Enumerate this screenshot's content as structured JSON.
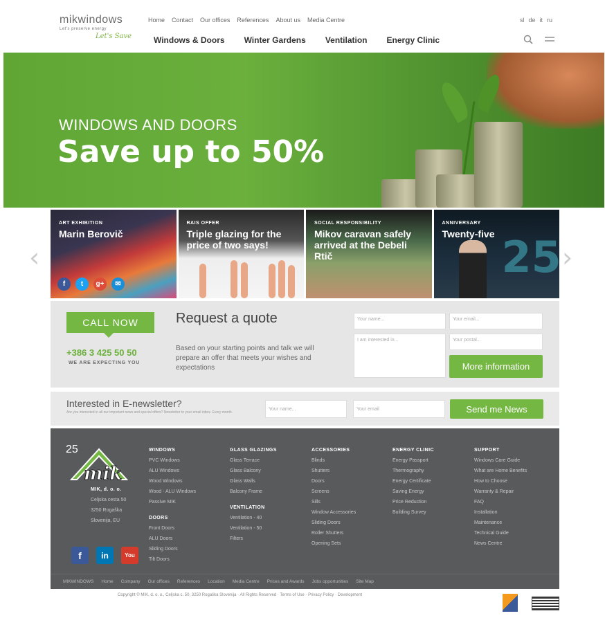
{
  "header": {
    "logo_text": "mikwindows",
    "logo_tagline": "Let's preserve energy",
    "logo_script": "Let's Save",
    "top_nav": [
      "Home",
      "Contact",
      "Our offices",
      "References",
      "About us",
      "Media Centre"
    ],
    "languages": [
      "sl",
      "de",
      "it",
      "ru"
    ],
    "main_nav": [
      "Windows & Doors",
      "Winter Gardens",
      "Ventilation",
      "Energy Clinic"
    ]
  },
  "hero": {
    "kicker": "WINDOWS AND DOORS",
    "title": "Save up to 50%"
  },
  "cards": [
    {
      "kicker": "ART EXHIBITION",
      "title": "Marin Berovič"
    },
    {
      "kicker": "RAIS OFFER",
      "title": "Triple glazing for the price of two says!"
    },
    {
      "kicker": "SOCIAL RESPONSIBILITY",
      "title": "Mikov caravan safely arrived at the Debeli Rtič"
    },
    {
      "kicker": "ANNIVERSARY",
      "title": "Twenty-five"
    }
  ],
  "anniversary_number": "25",
  "quote": {
    "call_now": "CALL NOW",
    "phone": "+386 3 425 50 50",
    "expecting": "WE ARE EXPECTING YOU",
    "title": "Request a quote",
    "text": "Based on your starting points and talk we will prepare an offer that meets your wishes and expectations",
    "name_placeholder": "Your name...",
    "email_placeholder": "Your email...",
    "interest_placeholder": "I am interested in...",
    "postal_placeholder": "Your postal...",
    "button": "More information"
  },
  "newsletter": {
    "title": "Interested in E-newsletter?",
    "subtitle": "Are you interested in all our important news and special offers? Newsletter to your email inbox. Every month.",
    "name_placeholder": "Your name...",
    "email_placeholder": "Your email",
    "button": "Send me News"
  },
  "footer": {
    "badge_year": "25",
    "company": "MIK, d. o. o.",
    "address": [
      "Celjska cesta 50",
      "3250 Rogaška",
      "Slovenija, EU"
    ],
    "columns": [
      {
        "heading": "WINDOWS",
        "items": [
          "PVC Windows",
          "ALU Windows",
          "Wood Windows",
          "Wood - ALU Windows",
          "Passive MIK"
        ]
      },
      {
        "heading": "GLASS GLAZINGS",
        "items": [
          "Glass Terrace",
          "Glass Balcony",
          "Glass Walls",
          "Balcony Frame"
        ]
      },
      {
        "heading": "ACCESSORIES",
        "items": [
          "Blinds",
          "Shutters",
          "Doors",
          "Screens",
          "Sills",
          "Window Accessories",
          "Sliding Doors",
          "Roller Shutters",
          "Opening Sets"
        ]
      },
      {
        "heading": "ENERGY CLINIC",
        "items": [
          "Energy Passport",
          "Thermography",
          "Energy Certificate",
          "Saving Energy",
          "Price Reduction",
          "Building Survey"
        ]
      },
      {
        "heading": "SUPPORT",
        "items": [
          "Windows Care Guide",
          "What are Home Benefits",
          "How to Choose",
          "Warranty & Repair",
          "FAQ",
          "Installation",
          "Maintenance",
          "Technical Guide",
          "News Centre"
        ]
      }
    ],
    "doors_heading": "DOORS",
    "doors_items": [
      "Front Doors",
      "ALU Doors",
      "Sliding Doors",
      "Tilt Doors"
    ],
    "ventilation_heading": "VENTILATION",
    "ventilation_items": [
      "Ventilation - 40",
      "Ventilation - 50",
      "Filters"
    ],
    "bottom_links": [
      "MIKWINDOWS",
      "Home",
      "Company",
      "Our offices",
      "References",
      "Location",
      "Media Centre",
      "Prices and Awards",
      "Jobs opportunities",
      "Site Map"
    ],
    "copyright": "Copyright © MIK, d. o. o., Celjska c. 50, 3250 Rogaška Slovenija · All Rights Reserved · Terms of Use · Privacy Policy · Development"
  },
  "colors": {
    "brand_green": "#74b843",
    "footer_gray": "#595a5c",
    "panel_gray": "#e6e6e6"
  }
}
